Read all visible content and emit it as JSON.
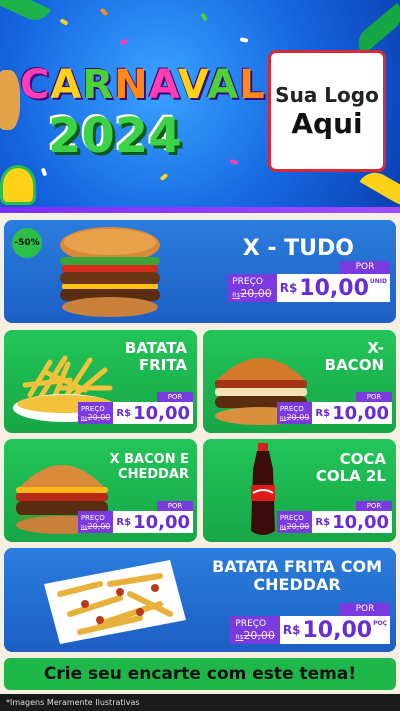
{
  "header": {
    "title_letters": [
      "C",
      "A",
      "R",
      "N",
      "A",
      "V",
      "A",
      "L"
    ],
    "year": "2024",
    "logo_line1": "Sua Logo",
    "logo_line2": "Aqui"
  },
  "products": [
    {
      "name": "X - TUDO",
      "badge": "-50%",
      "price_label": "PREÇO",
      "old_price": "20,00",
      "old_prefix": "R$",
      "por_label": "POR",
      "currency": "R$",
      "price": "10,00",
      "unit": "UNID",
      "image": "burger-icon"
    },
    {
      "name_line1": "BATATA",
      "name_line2": "FRITA",
      "price_label": "PREÇO",
      "old_price": "20,00",
      "old_prefix": "R$",
      "por_label": "POR",
      "currency": "R$",
      "price": "10,00",
      "image": "fries-icon"
    },
    {
      "name_line1": "X-",
      "name_line2": "BACON",
      "price_label": "PREÇO",
      "old_price": "20,00",
      "old_prefix": "R$",
      "por_label": "POR",
      "currency": "R$",
      "price": "10,00",
      "image": "bacon-burger-icon"
    },
    {
      "name_line1": "X BACON E",
      "name_line2": "CHEDDAR",
      "price_label": "PREÇO",
      "old_price": "20,00",
      "old_prefix": "R$",
      "por_label": "POR",
      "currency": "R$",
      "price": "10,00",
      "image": "cheddar-burger-icon"
    },
    {
      "name_line1": "COCA",
      "name_line2": "COLA 2L",
      "price_label": "PREÇO",
      "old_price": "20,00",
      "old_prefix": "R$",
      "por_label": "POR",
      "currency": "R$",
      "price": "10,00",
      "image": "soda-bottle-icon"
    },
    {
      "name_line1": "BATATA FRITA COM",
      "name_line2": "CHEDDAR",
      "price_label": "PREÇO",
      "old_price": "20,00",
      "old_prefix": "R$",
      "por_label": "POR",
      "currency": "R$",
      "price": "10,00",
      "unit": "POÇ",
      "image": "cheddar-fries-icon"
    }
  ],
  "footer": {
    "cta": "Crie seu encarte com este tema!",
    "disclaimer": "*Imagens Meramente Ilustrativas"
  },
  "colors": {
    "blue_card": "#1c5fc4",
    "green_card": "#17a646",
    "price_purple": "#7a3ae0",
    "cta_green": "#1fb64a"
  }
}
